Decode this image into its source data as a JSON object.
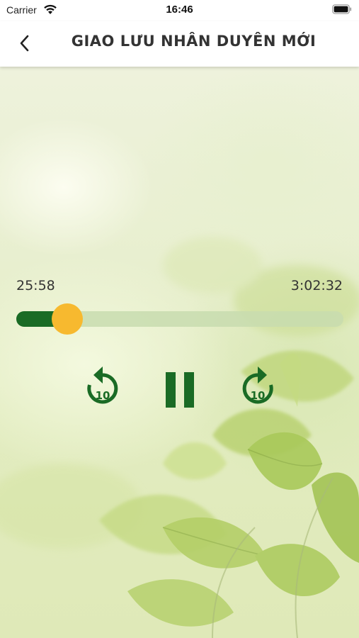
{
  "status_bar": {
    "carrier": "Carrier",
    "time": "16:46"
  },
  "header": {
    "title": "GIAO LƯU NHÂN DUYÊN MỚI",
    "back_icon": "chevron-left-icon"
  },
  "player": {
    "current_time": "25:58",
    "total_time": "3:02:32",
    "progress": 0.155,
    "rewind_seconds_label": "10",
    "forward_seconds_label": "10",
    "state_icon": "pause-icon"
  },
  "colors": {
    "accent_green": "#1a6b25",
    "thumb_yellow": "#f7b92f",
    "track_light": "#c8dcaf"
  }
}
